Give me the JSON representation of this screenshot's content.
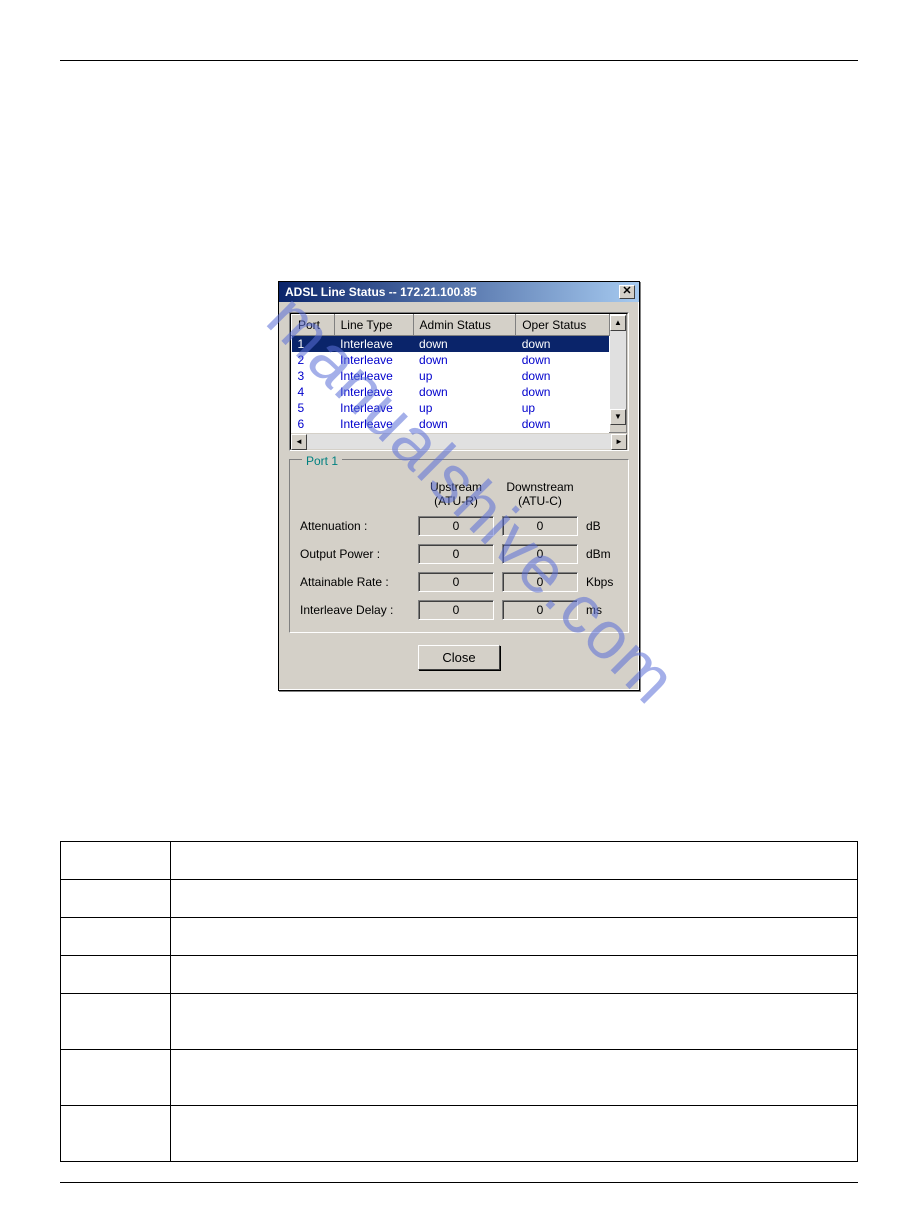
{
  "dialog": {
    "title": "ADSL Line Status -- 172.21.100.85",
    "columns": [
      "Port",
      "Line Type",
      "Admin Status",
      "Oper Status"
    ],
    "rows": [
      {
        "port": "1",
        "line_type": "Interleave",
        "admin": "down",
        "oper": "down",
        "selected": true
      },
      {
        "port": "2",
        "line_type": "Interleave",
        "admin": "down",
        "oper": "down"
      },
      {
        "port": "3",
        "line_type": "Interleave",
        "admin": "up",
        "oper": "down"
      },
      {
        "port": "4",
        "line_type": "Interleave",
        "admin": "down",
        "oper": "down"
      },
      {
        "port": "5",
        "line_type": "Interleave",
        "admin": "up",
        "oper": "up"
      },
      {
        "port": "6",
        "line_type": "Interleave",
        "admin": "down",
        "oper": "down"
      }
    ],
    "details": {
      "legend": "Port 1",
      "upstream_hdr": "Upstream\n(ATU-R)",
      "downstream_hdr": "Downstream\n(ATU-C)",
      "rows": [
        {
          "label": "Attenuation :",
          "up": "0",
          "down": "0",
          "unit": "dB"
        },
        {
          "label": "Output Power :",
          "up": "0",
          "down": "0",
          "unit": "dBm"
        },
        {
          "label": "Attainable Rate :",
          "up": "0",
          "down": "0",
          "unit": "Kbps"
        },
        {
          "label": "Interleave Delay :",
          "up": "0",
          "down": "0",
          "unit": "ms"
        }
      ]
    },
    "close_label": "Close"
  },
  "watermark": "manualshive.com"
}
